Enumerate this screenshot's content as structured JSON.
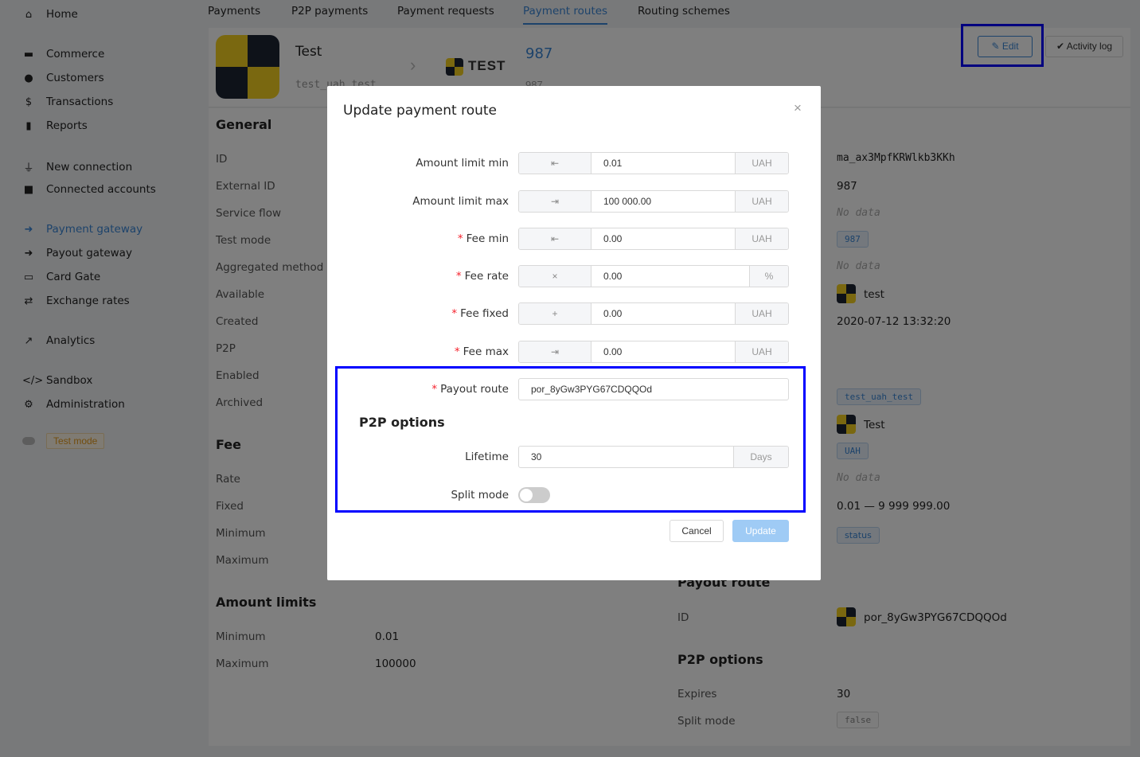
{
  "sidebar": {
    "items": [
      {
        "label": "Home",
        "icon": "home-icon"
      },
      {
        "label": "Commerce",
        "icon": "store-icon"
      },
      {
        "label": "Customers",
        "icon": "users-icon"
      },
      {
        "label": "Transactions",
        "icon": "dollar-circle-icon"
      },
      {
        "label": "Reports",
        "icon": "file-download-icon"
      },
      {
        "label": "New connection",
        "icon": "plug-icon"
      },
      {
        "label": "Connected accounts",
        "icon": "lock-icon"
      },
      {
        "label": "Payment gateway",
        "icon": "sign-in-icon",
        "active": true
      },
      {
        "label": "Payout gateway",
        "icon": "sign-out-icon"
      },
      {
        "label": "Card Gate",
        "icon": "credit-card-icon"
      },
      {
        "label": "Exchange rates",
        "icon": "retweet-icon"
      },
      {
        "label": "Analytics",
        "icon": "chart-line-icon"
      },
      {
        "label": "Sandbox",
        "icon": "code-icon"
      },
      {
        "label": "Administration",
        "icon": "gear-icon"
      }
    ],
    "test_mode": "Test mode"
  },
  "tabs": [
    "Payments",
    "P2P payments",
    "Payment requests",
    "Payment routes",
    "Routing schemes"
  ],
  "active_tab": "Payment routes",
  "header": {
    "title": "Test",
    "subtitle": "test_uah_test",
    "provider_logo_text": "TEST",
    "id": "987",
    "id_sub": "987",
    "edit": "Edit",
    "activity_log": "Activity log"
  },
  "general": {
    "heading": "General",
    "labels": [
      "ID",
      "External ID",
      "Service flow",
      "Test mode",
      "Aggregated method",
      "Available",
      "Created",
      "P2P",
      "Enabled",
      "Archived"
    ]
  },
  "fee": {
    "heading": "Fee",
    "labels": [
      "Rate",
      "Fixed",
      "Minimum",
      "Maximum"
    ]
  },
  "amount_limits": {
    "heading": "Amount limits",
    "min_label": "Minimum",
    "min": "0.01",
    "max_label": "Maximum",
    "max": "100000"
  },
  "right": {
    "id": "ma_ax3MpfKRWlkb3KKh",
    "external_id": "987",
    "no_data": "No data",
    "tag_987": "987",
    "account": "test",
    "created": "2020-07-12 13:32:20",
    "tag_code": "test_uah_test",
    "provider": "Test",
    "currency": "UAH",
    "range": "0.01 — 9 999 999.00",
    "status": "status",
    "payout_heading": "Payout route",
    "payout_id_label": "ID",
    "payout_id": "por_8yGw3PYG67CDQQOd",
    "p2p_heading": "P2P options",
    "expires_label": "Expires",
    "expires": "30",
    "split_label": "Split mode",
    "split": "false"
  },
  "modal": {
    "title": "Update payment route",
    "rows": [
      {
        "label": "Amount limit min",
        "required": false,
        "prefix": "⇤",
        "value": "0.01",
        "suffix": "UAH"
      },
      {
        "label": "Amount limit max",
        "required": false,
        "prefix": "⇥",
        "value": "100 000.00",
        "suffix": "UAH"
      },
      {
        "label": "Fee min",
        "required": true,
        "prefix": "⇤",
        "value": "0.00",
        "suffix": "UAH"
      },
      {
        "label": "Fee rate",
        "required": true,
        "prefix": "×",
        "value": "0.00",
        "suffix": "%"
      },
      {
        "label": "Fee fixed",
        "required": true,
        "prefix": "+",
        "value": "0.00",
        "suffix": "UAH"
      },
      {
        "label": "Fee max",
        "required": true,
        "prefix": "⇥",
        "value": "0.00",
        "suffix": "UAH"
      }
    ],
    "payout_route_label": "Payout route",
    "payout_route": "por_8yGw3PYG67CDQQOd",
    "p2p_heading": "P2P options",
    "lifetime_label": "Lifetime",
    "lifetime": "30",
    "lifetime_unit": "Days",
    "split_label": "Split mode",
    "split_on": false,
    "cancel": "Cancel",
    "update": "Update"
  },
  "colors": {
    "accent": "#3a86d6",
    "highlight": "#0000ff",
    "required": "#f5222d"
  }
}
